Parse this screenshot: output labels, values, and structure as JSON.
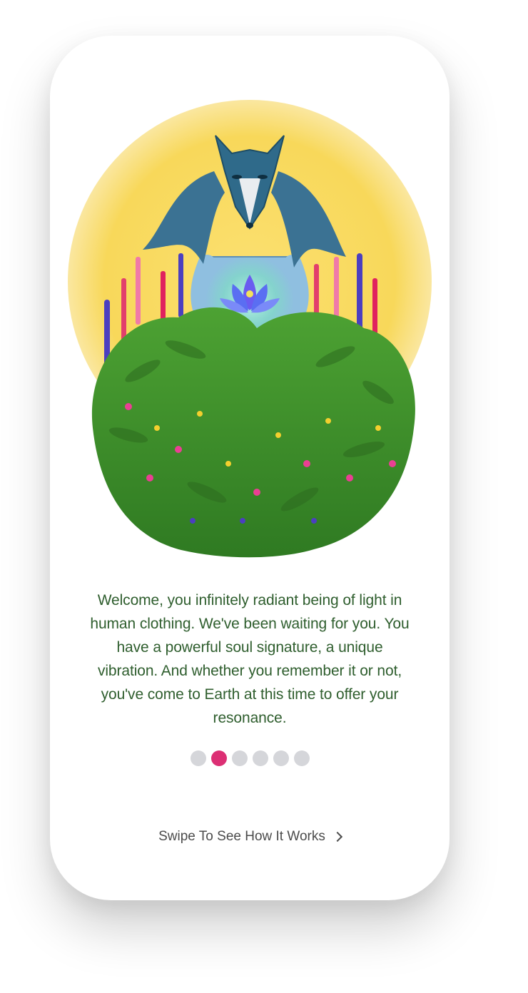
{
  "onboarding": {
    "illustration_icon": "wolf-headed-figure-with-lotus-in-wildflower-meadow",
    "message": "Welcome, you infinitely radiant being of light in human clothing. We've been waiting for you. You have a powerful soul signature, a unique vibration. And whether you remember it or not, you've come to Earth at this time to offer your resonance.",
    "pagination": {
      "total": 6,
      "active_index": 1
    },
    "swipe_label": "Swipe To See How It Works",
    "swipe_icon": "chevron-right-icon"
  },
  "colors": {
    "text_green": "#2f5e2e",
    "dot_active": "#dc2f74",
    "dot_inactive": "#d5d6da",
    "sun_yellow": "#f8d85a",
    "meadow_green": "#3f8e2a",
    "figure_blue": "#8fbfe0"
  }
}
